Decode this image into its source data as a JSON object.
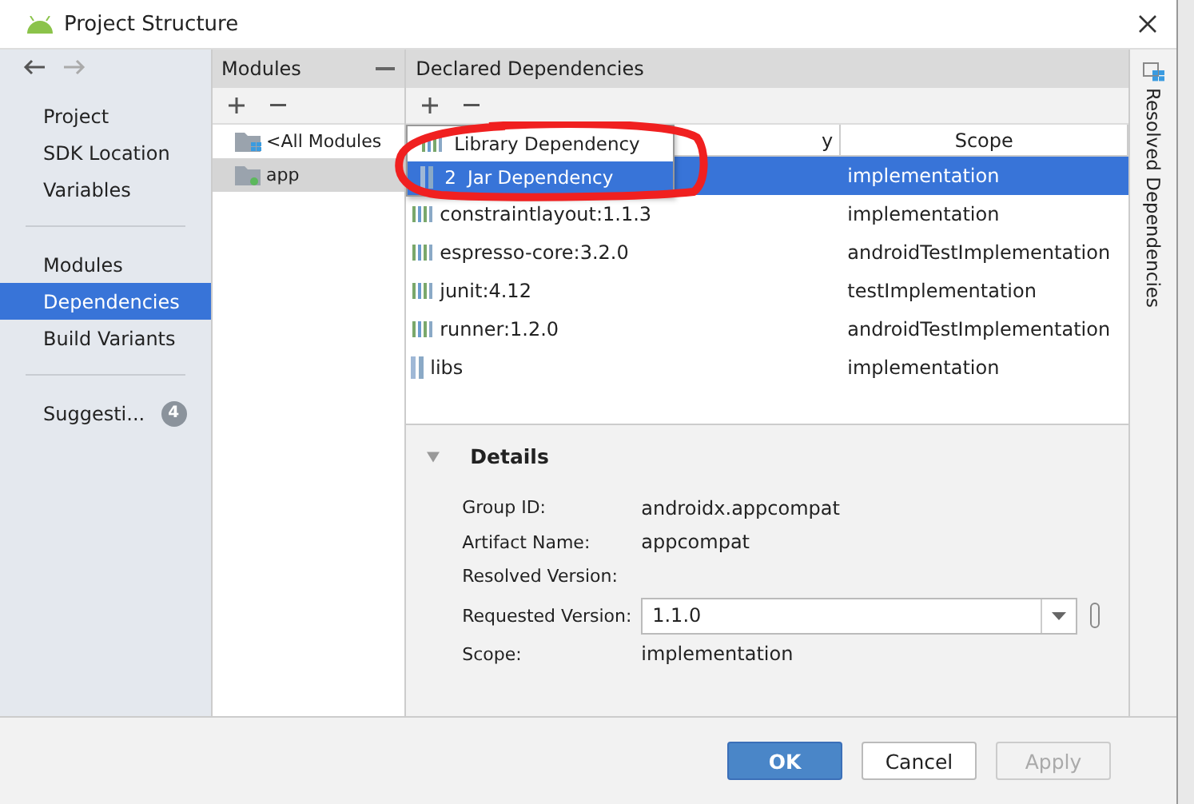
{
  "window": {
    "title": "Project Structure"
  },
  "sidebar": {
    "groups": [
      [
        {
          "label": "Project",
          "selected": false
        },
        {
          "label": "SDK Location",
          "selected": false
        },
        {
          "label": "Variables",
          "selected": false
        }
      ],
      [
        {
          "label": "Modules",
          "selected": false
        },
        {
          "label": "Dependencies",
          "selected": true
        },
        {
          "label": "Build Variants",
          "selected": false
        }
      ],
      [
        {
          "label": "Suggesti...",
          "badge": "4",
          "selected": false
        }
      ]
    ]
  },
  "modules": {
    "title": "Modules",
    "items": [
      {
        "label": "<All Modules",
        "kind": "all",
        "selected": false
      },
      {
        "label": "app",
        "kind": "module",
        "selected": true
      }
    ]
  },
  "dependencies": {
    "title": "Declared Dependencies",
    "columns": [
      "y",
      "Scope"
    ],
    "rows": [
      {
        "scope": "implementation",
        "selected": true
      },
      {
        "name": "constraintlayout:1.1.3",
        "kind": "library",
        "scope": "implementation",
        "selected": false
      },
      {
        "name": "espresso-core:3.2.0",
        "kind": "library",
        "scope": "androidTestImplementation",
        "selected": false
      },
      {
        "name": "junit:4.12",
        "kind": "library",
        "scope": "testImplementation",
        "selected": false
      },
      {
        "name": "runner:1.2.0",
        "kind": "library",
        "scope": "androidTestImplementation",
        "selected": false
      },
      {
        "name": "libs",
        "kind": "jar",
        "scope": "implementation",
        "selected": false
      }
    ],
    "popup": [
      {
        "label": "Library Dependency",
        "kind": "library",
        "selected": false
      },
      {
        "key": "2",
        "label": "Jar Dependency",
        "kind": "jar",
        "selected": true
      }
    ]
  },
  "details": {
    "title": "Details",
    "expanded": true,
    "fields": [
      {
        "label": "Group ID:",
        "value": "androidx.appcompat",
        "kind": "text"
      },
      {
        "label": "Artifact Name:",
        "value": "appcompat",
        "kind": "text"
      },
      {
        "label": "Resolved Version:",
        "kind": "text"
      },
      {
        "label": "Requested Version:",
        "value": "1.1.0",
        "kind": "dropdown"
      },
      {
        "label": "Scope:",
        "value": "implementation",
        "kind": "text"
      }
    ]
  },
  "side_tab": "Resolved Dependencies",
  "buttons": [
    {
      "label": "OK",
      "primary": true,
      "disabled": false
    },
    {
      "label": "Cancel",
      "primary": false,
      "disabled": false
    },
    {
      "label": "Apply",
      "primary": false,
      "disabled": true
    }
  ]
}
